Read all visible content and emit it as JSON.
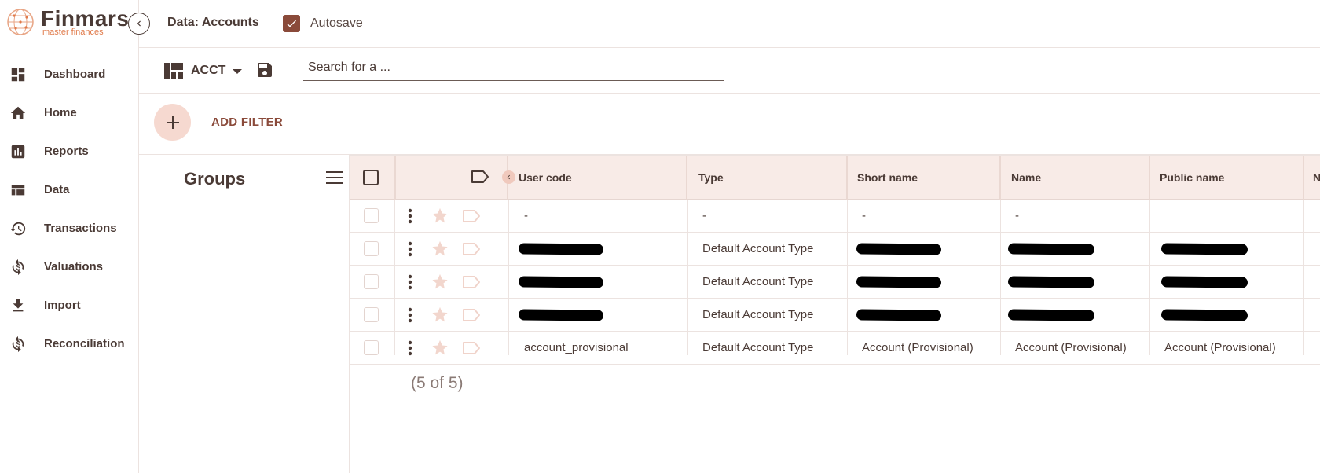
{
  "app": {
    "logo_title": "Finmars",
    "logo_subtitle": "master finances"
  },
  "header": {
    "title": "Data: Accounts",
    "autosave_label": "Autosave",
    "autosave_checked": true
  },
  "toolbar": {
    "layout_name": "ACCT",
    "search_placeholder": "Search for a ..."
  },
  "filters": {
    "add_label": "ADD FILTER"
  },
  "sidebar": {
    "items": [
      {
        "label": "Dashboard",
        "icon": "dashboard-icon"
      },
      {
        "label": "Home",
        "icon": "home-icon"
      },
      {
        "label": "Reports",
        "icon": "reports-icon"
      },
      {
        "label": "Data",
        "icon": "data-icon"
      },
      {
        "label": "Transactions",
        "icon": "history-icon"
      },
      {
        "label": "Valuations",
        "icon": "valuation-icon"
      },
      {
        "label": "Import",
        "icon": "download-icon"
      },
      {
        "label": "Reconciliation",
        "icon": "reconciliation-icon"
      }
    ]
  },
  "groups": {
    "title": "Groups"
  },
  "table": {
    "columns": [
      "User code",
      "Type",
      "Short name",
      "Name",
      "Public name",
      "N"
    ],
    "rows": [
      {
        "user_code": "-",
        "type": "-",
        "short_name": "-",
        "name": "-",
        "public_name": "",
        "redacted": false
      },
      {
        "user_code": "",
        "type": "Default Account Type",
        "short_name": "",
        "name": "",
        "public_name": "",
        "redacted": true
      },
      {
        "user_code": "",
        "type": "Default Account Type",
        "short_name": "",
        "name": "",
        "public_name": "",
        "redacted": true
      },
      {
        "user_code": "",
        "type": "Default Account Type",
        "short_name": "",
        "name": "",
        "public_name": "",
        "redacted": true
      },
      {
        "user_code": "account_provisional",
        "type": "Default Account Type",
        "short_name": "Account (Provisional)",
        "name": "Account (Provisional)",
        "public_name": "Account (Provisional)",
        "redacted": false
      }
    ],
    "count_label": "(5 of 5)"
  },
  "colors": {
    "primary": "#4a3a35",
    "accent": "#8a4a3a",
    "header_bg": "#f8ebe7",
    "filter_circle": "#f6d9d0"
  }
}
